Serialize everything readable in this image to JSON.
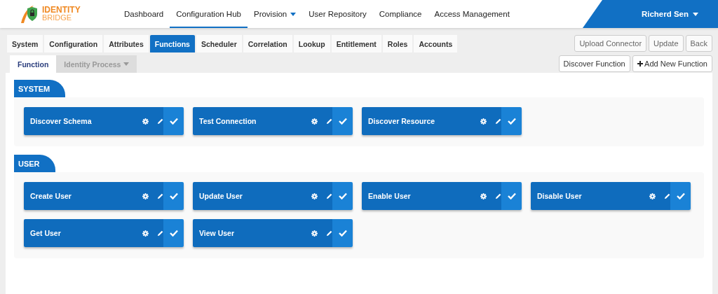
{
  "logo": {
    "line1": "IDENTITY",
    "line2": "BRIDGE"
  },
  "nav": [
    {
      "label": "Dashboard",
      "selected": false,
      "dropdown": false
    },
    {
      "label": "Configuration Hub",
      "selected": true,
      "dropdown": false
    },
    {
      "label": "Provision",
      "selected": false,
      "dropdown": true
    },
    {
      "label": "User Repository",
      "selected": false,
      "dropdown": false
    },
    {
      "label": "Compliance",
      "selected": false,
      "dropdown": false
    },
    {
      "label": "Access Management",
      "selected": false,
      "dropdown": false
    }
  ],
  "user": {
    "name": "Richerd Sen"
  },
  "tabs": [
    {
      "label": "System",
      "selected": false
    },
    {
      "label": "Configuration",
      "selected": false
    },
    {
      "label": "Attributes",
      "selected": false
    },
    {
      "label": "Functions",
      "selected": true
    },
    {
      "label": "Scheduler",
      "selected": false
    },
    {
      "label": "Correlation",
      "selected": false
    },
    {
      "label": "Lookup",
      "selected": false
    },
    {
      "label": "Entitlement",
      "selected": false
    },
    {
      "label": "Roles",
      "selected": false
    },
    {
      "label": "Accounts",
      "selected": false
    }
  ],
  "top_buttons": [
    "Upload Connector",
    "Update",
    "Back"
  ],
  "subtabs": [
    {
      "label": "Function",
      "selected": true,
      "dropdown": false
    },
    {
      "label": "Identity Process",
      "selected": false,
      "dropdown": true
    }
  ],
  "sub_buttons": [
    {
      "label": "Discover Function",
      "plus": false
    },
    {
      "label": "Add New Function",
      "plus": true
    }
  ],
  "sections": [
    {
      "title": "SYSTEM",
      "functions": [
        {
          "name": "Discover Schema",
          "enabled": true
        },
        {
          "name": "Test Connection",
          "enabled": true
        },
        {
          "name": "Discover Resource",
          "enabled": true
        }
      ]
    },
    {
      "title": "USER",
      "functions": [
        {
          "name": "Create User",
          "enabled": true
        },
        {
          "name": "Update User",
          "enabled": true
        },
        {
          "name": "Enable User",
          "enabled": true
        },
        {
          "name": "Disable User",
          "enabled": true
        },
        {
          "name": "Get User",
          "enabled": true
        },
        {
          "name": "View User",
          "enabled": true
        }
      ]
    }
  ]
}
